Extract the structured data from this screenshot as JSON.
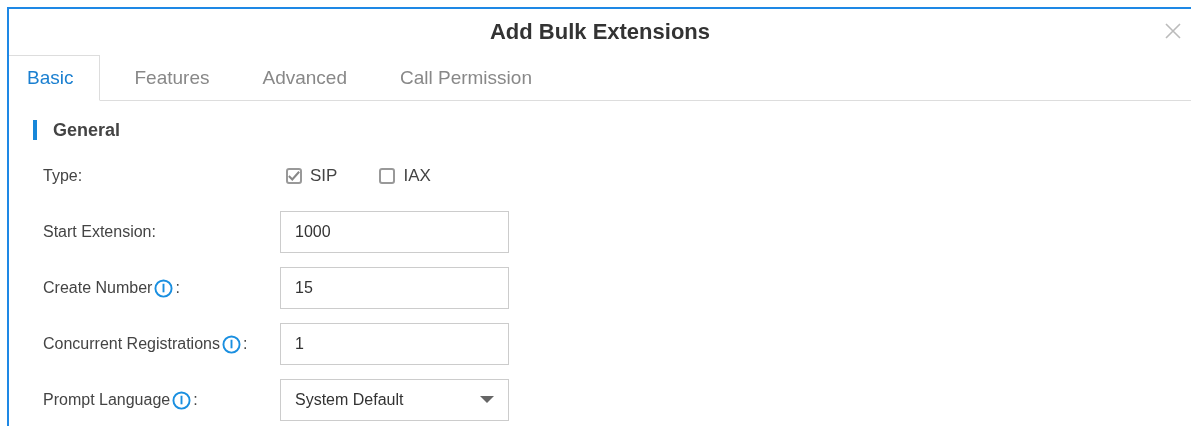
{
  "dialog": {
    "title": "Add Bulk Extensions"
  },
  "tabs": [
    {
      "label": "Basic",
      "selected": true
    },
    {
      "label": "Features",
      "selected": false
    },
    {
      "label": "Advanced",
      "selected": false
    },
    {
      "label": "Call Permission",
      "selected": false
    }
  ],
  "section": {
    "title": "General"
  },
  "fields": [
    {
      "kind": "checkboxes",
      "label": "Type",
      "info": false,
      "options": [
        {
          "label": "SIP",
          "checked": true
        },
        {
          "label": "IAX",
          "checked": false
        }
      ]
    },
    {
      "kind": "text",
      "label": "Start Extension",
      "info": false,
      "value": "1000"
    },
    {
      "kind": "text",
      "label": "Create Number",
      "info": true,
      "value": "15"
    },
    {
      "kind": "text",
      "label": "Concurrent Registrations",
      "info": true,
      "value": "1"
    },
    {
      "kind": "select",
      "label": "Prompt Language",
      "info": true,
      "value": "System Default"
    }
  ],
  "colon": ":"
}
